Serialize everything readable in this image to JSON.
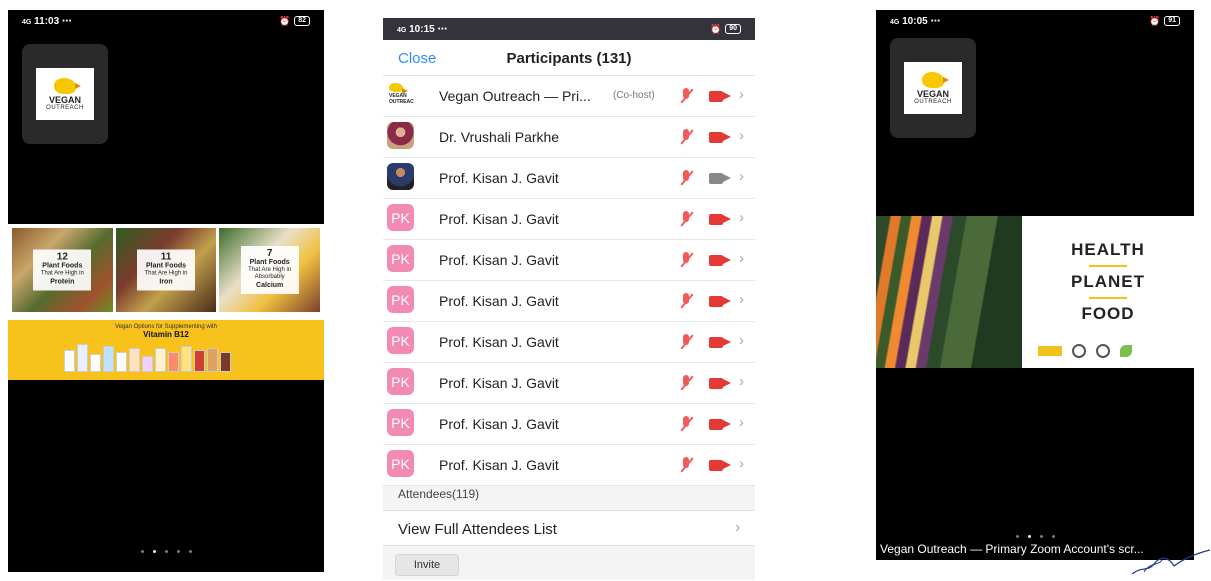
{
  "phone1": {
    "status": {
      "time": "11:03",
      "signal": "4G",
      "battery": "82"
    },
    "tile": {
      "logo_brand": "VEGAN",
      "logo_sub": "OUTREACH"
    },
    "share": {
      "cards": [
        {
          "count": "12",
          "title": "Plant Foods",
          "line1": "That Are High in",
          "line2": "Protein"
        },
        {
          "count": "11",
          "title": "Plant Foods",
          "line1": "That Are High in",
          "line2": "Iron"
        },
        {
          "count": "7",
          "title": "Plant Foods",
          "line1": "That Are High in Absorbably",
          "line2": "Calcium"
        }
      ],
      "banner_line1": "Vegan Options for Supplementing with",
      "banner_line2": "Vitamin B12"
    },
    "page_dots": 5,
    "active_dot": 1
  },
  "phone2": {
    "status": {
      "time": "10:15",
      "signal": "4G",
      "battery": "90"
    },
    "header": {
      "close_label": "Close",
      "title": "Participants (131)"
    },
    "participants": [
      {
        "name": "Vegan Outreach — Pri...",
        "role": "(Co-host)",
        "avatar": "logo",
        "video": "off"
      },
      {
        "name": "Dr. Vrushali Parkhe",
        "role": "",
        "avatar": "photo1",
        "video": "off"
      },
      {
        "name": "Prof. Kisan J. Gavit",
        "role": "",
        "avatar": "photo2",
        "video": "on"
      },
      {
        "name": "Prof. Kisan J. Gavit",
        "role": "",
        "avatar": "PK",
        "video": "off"
      },
      {
        "name": "Prof. Kisan J. Gavit",
        "role": "",
        "avatar": "PK",
        "video": "off"
      },
      {
        "name": "Prof. Kisan J. Gavit",
        "role": "",
        "avatar": "PK",
        "video": "off"
      },
      {
        "name": "Prof. Kisan J. Gavit",
        "role": "",
        "avatar": "PK",
        "video": "off"
      },
      {
        "name": "Prof. Kisan J. Gavit",
        "role": "",
        "avatar": "PK",
        "video": "off"
      },
      {
        "name": "Prof. Kisan J. Gavit",
        "role": "",
        "avatar": "PK",
        "video": "off"
      },
      {
        "name": "Prof. Kisan J. Gavit",
        "role": "",
        "avatar": "PK",
        "video": "off"
      }
    ],
    "avatar_logo_text": "VEGAN OUTREACH",
    "attendees_label": "Attendees(119)",
    "view_full_label": "View Full Attendees List",
    "invite_label": "Invite"
  },
  "phone3": {
    "status": {
      "time": "10:05",
      "signal": "4G",
      "battery": "91"
    },
    "tile": {
      "logo_brand": "VEGAN",
      "logo_sub": "OUTREACH"
    },
    "share": {
      "words": [
        "HEALTH",
        "PLANET",
        "FOOD"
      ]
    },
    "caption": "Vegan Outreach — Primary Zoom Account's scr...",
    "page_dots": 4,
    "active_dot": 1
  },
  "colors": {
    "zoom_blue": "#2d8cff",
    "muted_red": "#e53935",
    "pk_pink": "#f28ab3",
    "brand_yellow": "#f2c21c"
  }
}
